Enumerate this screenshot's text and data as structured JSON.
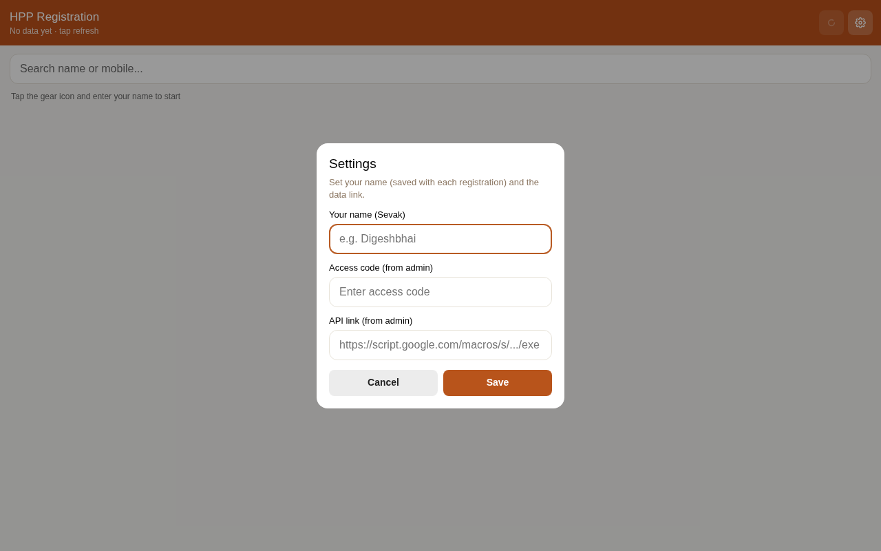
{
  "header": {
    "title": "HPP Registration",
    "subtitle": "No data yet · tap refresh",
    "buttons": [
      {
        "kind": "refresh",
        "disabled": true
      },
      {
        "kind": "settings",
        "disabled": false
      }
    ]
  },
  "search": {
    "placeholder": "Search name or mobile..."
  },
  "hint": "Tap the gear icon and enter your name to start",
  "dialog": {
    "title": "Settings",
    "description": "Set your name (saved with each registration) and the data link.",
    "fields": [
      {
        "label": "Your name (Sevak)",
        "placeholder": "e.g. Digeshbhai",
        "focused": true
      },
      {
        "label": "Access code (from admin)",
        "placeholder": "Enter access code",
        "focused": false
      },
      {
        "label": "API link (from admin)",
        "placeholder": "https://script.google.com/macros/s/.../exe",
        "focused": false
      }
    ],
    "buttons": [
      {
        "label": "Cancel",
        "kind": "secondary"
      },
      {
        "label": "Save",
        "kind": "primary"
      }
    ]
  }
}
